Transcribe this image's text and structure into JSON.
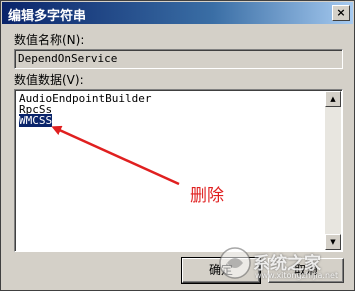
{
  "window": {
    "title": "编辑多字符串",
    "close_glyph": "×"
  },
  "value_name": {
    "label": "数值名称(N):",
    "value": "DependOnService"
  },
  "value_data": {
    "label": "数值数据(V):",
    "lines": [
      "AudioEndpointBuilder",
      "RpcSs",
      "WMCSS"
    ],
    "selected_index": 2
  },
  "annotation": {
    "text": "删除",
    "color": "#e02020"
  },
  "buttons": {
    "ok_label": "确定",
    "cancel_label": "取消"
  },
  "watermark": {
    "text": "系统之家",
    "sub": "www.xitongzhijia.net"
  },
  "colors": {
    "selection": "#0a246a",
    "dialog_face": "#d4d0c8",
    "arrow": "#e02020"
  }
}
